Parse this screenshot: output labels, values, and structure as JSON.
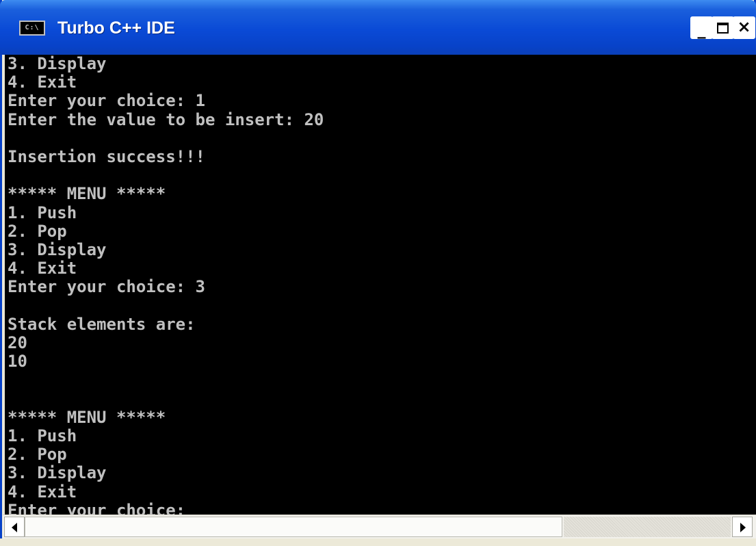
{
  "window": {
    "title": "Turbo C++ IDE",
    "icon_label": "C:\\",
    "icon": "console-icon",
    "controls": {
      "minimize_label": "_",
      "maximize_icon": "maximize-icon",
      "close_label": "×"
    }
  },
  "console": {
    "text": "3. Display\n4. Exit\nEnter your choice: 1\nEnter the value to be insert: 20\n\nInsertion success!!!\n\n***** MENU *****\n1. Push\n2. Pop\n3. Display\n4. Exit\nEnter your choice: 3\n\nStack elements are:\n20\n10\n\n\n***** MENU *****\n1. Push\n2. Pop\n3. Display\n4. Exit\nEnter your choice:"
  },
  "scrollbar": {
    "left_icon": "arrow-left-icon",
    "right_icon": "arrow-right-icon"
  },
  "colors": {
    "titlebar": "#0842c8",
    "console_background": "#000000",
    "console_text": "#c0c0c0"
  }
}
